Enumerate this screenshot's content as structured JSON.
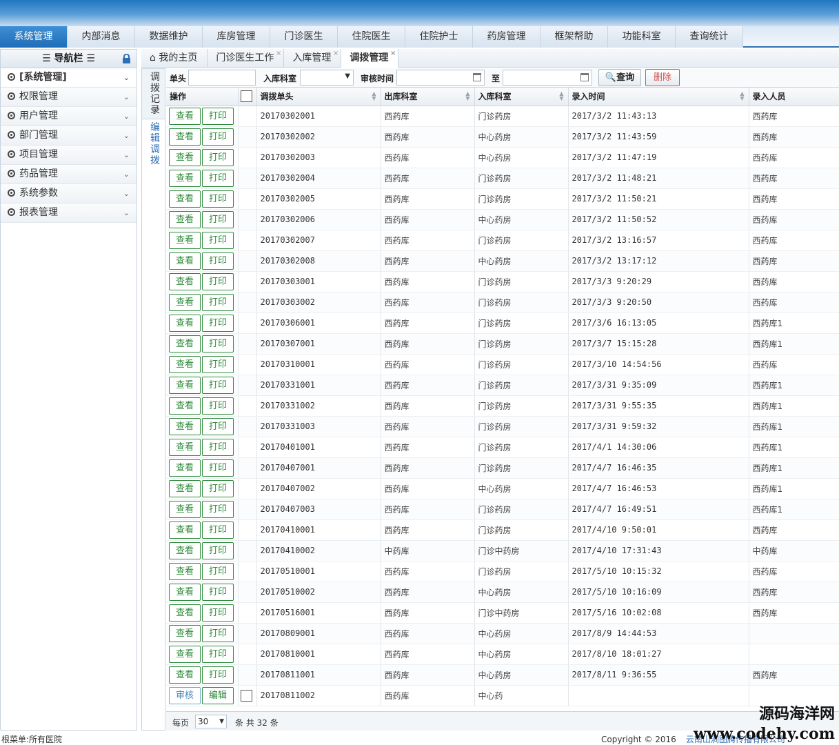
{
  "top_menu": [
    "系统管理",
    "内部消息",
    "数据维护",
    "库房管理",
    "门诊医生",
    "住院医生",
    "住院护士",
    "药房管理",
    "框架帮助",
    "功能科室",
    "查询统计"
  ],
  "sidebar": {
    "title": "导航栏",
    "items": [
      "[系统管理]",
      "权限管理",
      "用户管理",
      "部门管理",
      "项目管理",
      "药品管理",
      "系统参数",
      "报表管理"
    ]
  },
  "tabs": [
    "我的主页",
    "门诊医生工作",
    "入库管理",
    "调拨管理"
  ],
  "subtabs": [
    "调拨记录",
    "编辑调拨"
  ],
  "query": {
    "doc_no_label": "单头",
    "in_dept_label": "入库科室",
    "review_time_label": "审核时间",
    "to_label": "至",
    "search_button": "查询",
    "delete_button": "删除"
  },
  "grid": {
    "headers": [
      "操作",
      "调拨单头",
      "出库科室",
      "入库科室",
      "录入时间",
      "录入人员"
    ],
    "view_label": "查看",
    "print_label": "打印",
    "audit_label": "审核",
    "edit_label": "编辑",
    "rows": [
      {
        "no": "20170302001",
        "out": "西药库",
        "in": "门诊药房",
        "time": "2017/3/2 11:43:13",
        "user": "西药库"
      },
      {
        "no": "20170302002",
        "out": "西药库",
        "in": "中心药房",
        "time": "2017/3/2 11:43:59",
        "user": "西药库"
      },
      {
        "no": "20170302003",
        "out": "西药库",
        "in": "中心药房",
        "time": "2017/3/2 11:47:19",
        "user": "西药库"
      },
      {
        "no": "20170302004",
        "out": "西药库",
        "in": "门诊药房",
        "time": "2017/3/2 11:48:21",
        "user": "西药库"
      },
      {
        "no": "20170302005",
        "out": "西药库",
        "in": "门诊药房",
        "time": "2017/3/2 11:50:21",
        "user": "西药库"
      },
      {
        "no": "20170302006",
        "out": "西药库",
        "in": "中心药房",
        "time": "2017/3/2 11:50:52",
        "user": "西药库"
      },
      {
        "no": "20170302007",
        "out": "西药库",
        "in": "门诊药房",
        "time": "2017/3/2 13:16:57",
        "user": "西药库"
      },
      {
        "no": "20170302008",
        "out": "西药库",
        "in": "中心药房",
        "time": "2017/3/2 13:17:12",
        "user": "西药库"
      },
      {
        "no": "20170303001",
        "out": "西药库",
        "in": "门诊药房",
        "time": "2017/3/3 9:20:29",
        "user": "西药库"
      },
      {
        "no": "20170303002",
        "out": "西药库",
        "in": "门诊药房",
        "time": "2017/3/3 9:20:50",
        "user": "西药库"
      },
      {
        "no": "20170306001",
        "out": "西药库",
        "in": "门诊药房",
        "time": "2017/3/6 16:13:05",
        "user": "西药库1"
      },
      {
        "no": "20170307001",
        "out": "西药库",
        "in": "门诊药房",
        "time": "2017/3/7 15:15:28",
        "user": "西药库1"
      },
      {
        "no": "20170310001",
        "out": "西药库",
        "in": "门诊药房",
        "time": "2017/3/10 14:54:56",
        "user": "西药库"
      },
      {
        "no": "20170331001",
        "out": "西药库",
        "in": "门诊药房",
        "time": "2017/3/31 9:35:09",
        "user": "西药库1"
      },
      {
        "no": "20170331002",
        "out": "西药库",
        "in": "门诊药房",
        "time": "2017/3/31 9:55:35",
        "user": "西药库1"
      },
      {
        "no": "20170331003",
        "out": "西药库",
        "in": "门诊药房",
        "time": "2017/3/31 9:59:32",
        "user": "西药库1"
      },
      {
        "no": "20170401001",
        "out": "西药库",
        "in": "门诊药房",
        "time": "2017/4/1 14:30:06",
        "user": "西药库1"
      },
      {
        "no": "20170407001",
        "out": "西药库",
        "in": "门诊药房",
        "time": "2017/4/7 16:46:35",
        "user": "西药库1"
      },
      {
        "no": "20170407002",
        "out": "西药库",
        "in": "中心药房",
        "time": "2017/4/7 16:46:53",
        "user": "西药库1"
      },
      {
        "no": "20170407003",
        "out": "西药库",
        "in": "门诊药房",
        "time": "2017/4/7 16:49:51",
        "user": "西药库1"
      },
      {
        "no": "20170410001",
        "out": "西药库",
        "in": "门诊药房",
        "time": "2017/4/10 9:50:01",
        "user": "西药库"
      },
      {
        "no": "20170410002",
        "out": "中药库",
        "in": "门诊中药房",
        "time": "2017/4/10 17:31:43",
        "user": "中药库"
      },
      {
        "no": "20170510001",
        "out": "西药库",
        "in": "门诊药房",
        "time": "2017/5/10 10:15:32",
        "user": "西药库"
      },
      {
        "no": "20170510002",
        "out": "西药库",
        "in": "中心药房",
        "time": "2017/5/10 10:16:09",
        "user": "西药库"
      },
      {
        "no": "20170516001",
        "out": "西药库",
        "in": "门诊中药房",
        "time": "2017/5/16 10:02:08",
        "user": "西药库"
      },
      {
        "no": "20170809001",
        "out": "西药库",
        "in": "中心药房",
        "time": "2017/8/9 14:44:53",
        "user": ""
      },
      {
        "no": "20170810001",
        "out": "西药库",
        "in": "中心药房",
        "time": "2017/8/10 18:01:27",
        "user": ""
      },
      {
        "no": "20170811001",
        "out": "西药库",
        "in": "中心药房",
        "time": "2017/8/11 9:36:55",
        "user": "西药库"
      }
    ],
    "pending_row": {
      "no": "20170811002",
      "out": "西药库",
      "in": "中心药"
    }
  },
  "pager": {
    "per_page_label": "每页",
    "page_size": "30",
    "total_text": "条 共 32 条"
  },
  "footer": {
    "left": "根菜单:所有医院",
    "copyright": "Copyright © 2016",
    "company": "云南山涧图腾传播有限公司"
  },
  "watermark": {
    "line1": "源码海洋网",
    "line2": "www.codehy.com"
  },
  "colors": {
    "menu_active": "#1f6db7",
    "button_green": "#2e8b3a",
    "delete_red": "#d9534f",
    "link_blue": "#2c6fb4"
  }
}
